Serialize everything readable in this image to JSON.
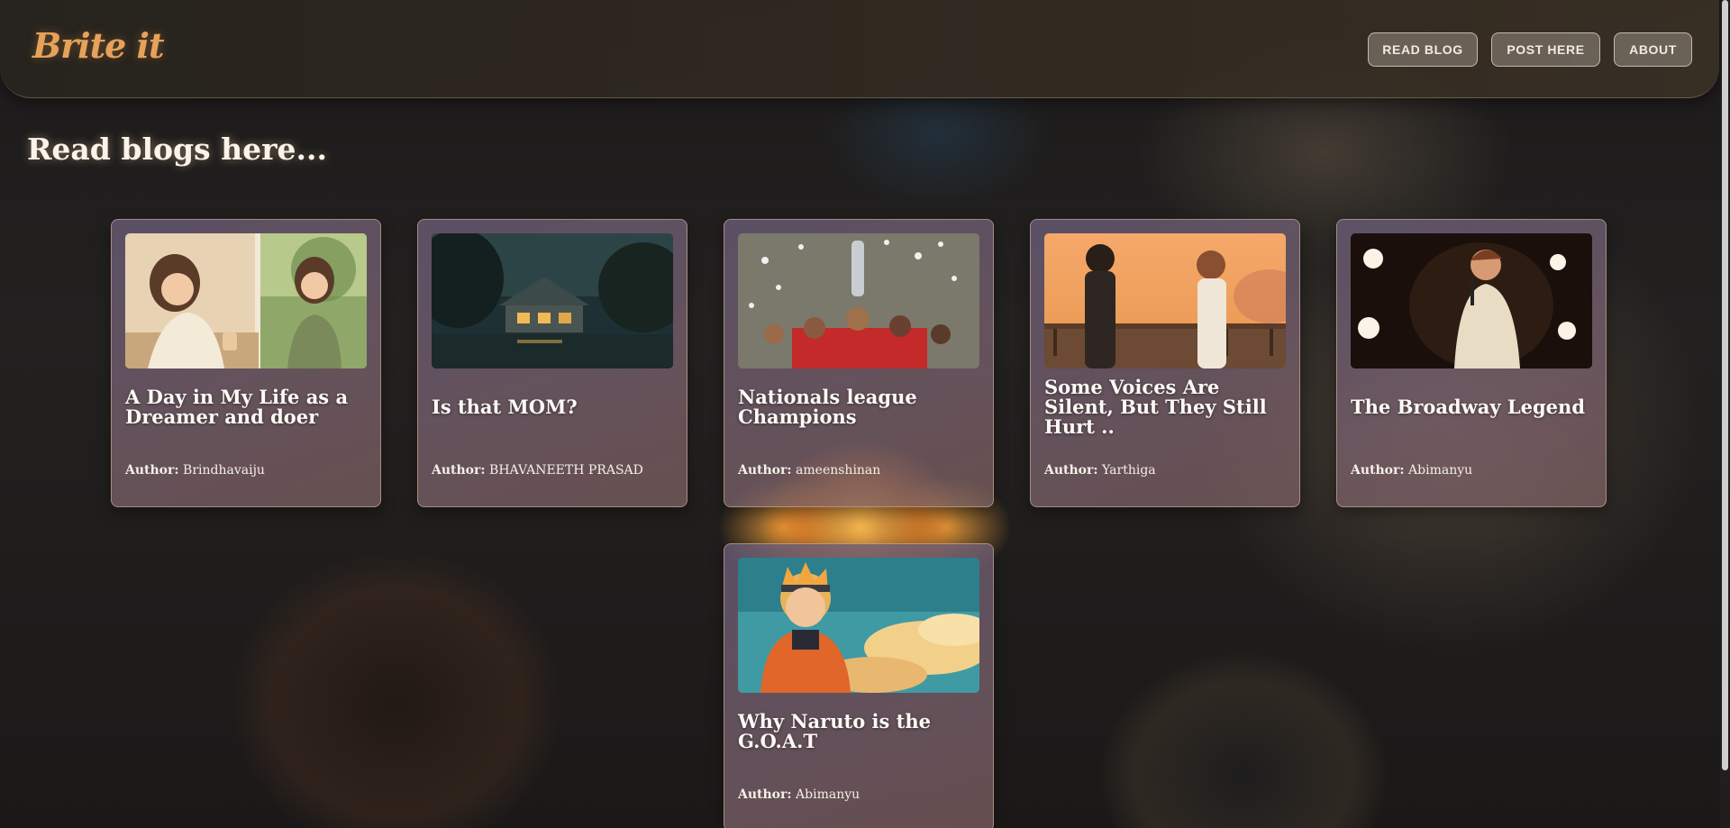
{
  "app": {
    "logo": "Brite it"
  },
  "nav": {
    "read_blog": "READ BLOG",
    "post_here": "POST HERE",
    "about": "ABOUT"
  },
  "page": {
    "heading": "Read blogs here..."
  },
  "author_label": "Author:",
  "cards": [
    {
      "title": "A Day in My Life as a Dreamer and doer",
      "author": "Brindhavaiju",
      "image": "illustration-girl-writing-and-listening-music"
    },
    {
      "title": "Is that MOM?",
      "author": "BHAVANEETH PRASAD",
      "image": "house-in-rainy-night"
    },
    {
      "title": "Nationals league Champions",
      "author": "ameenshinan",
      "image": "team-lifting-trophy"
    },
    {
      "title": "Some Voices Are Silent, But They Still Hurt ..",
      "author": "Yarthiga",
      "image": "anime-couple-at-sunset"
    },
    {
      "title": "The Broadway Legend",
      "author": "Abimanyu",
      "image": "performer-on-stage"
    },
    {
      "title": "Why Naruto is the G.O.A.T",
      "author": "Abimanyu",
      "image": "naruto-selfie-sky"
    }
  ],
  "colors": {
    "logo": "#e6a25a",
    "card_bg": "#6e5f78",
    "nav_bg": "#968c82"
  }
}
